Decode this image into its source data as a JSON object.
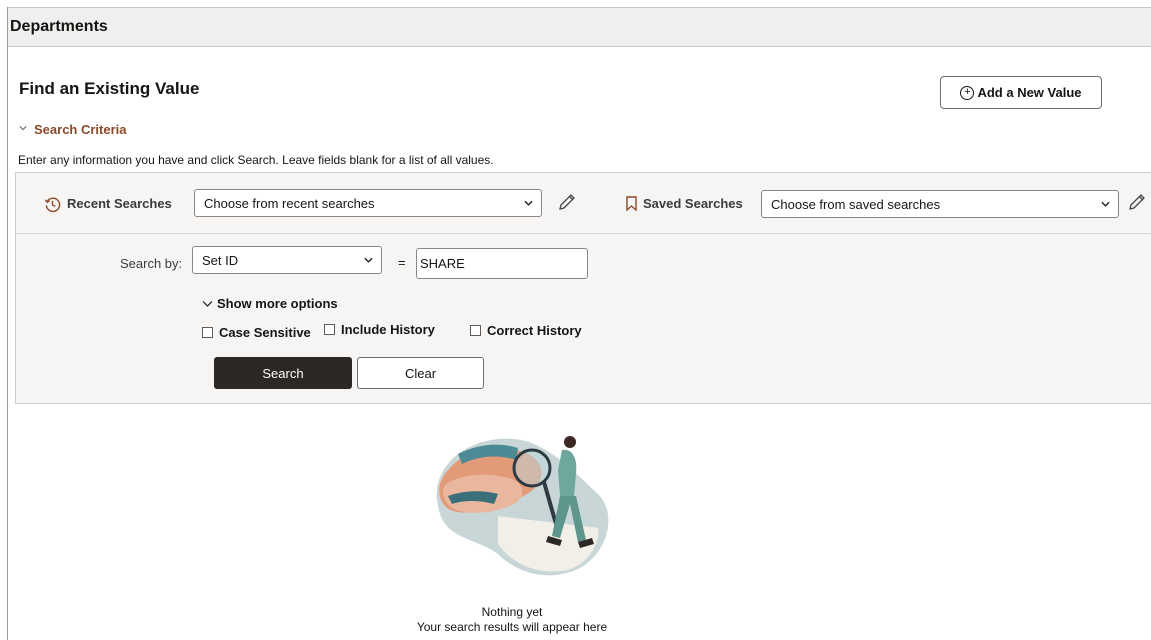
{
  "header": {
    "title": "Departments"
  },
  "page": {
    "heading": "Find an Existing Value",
    "add_button_label": "Add a New Value"
  },
  "criteria": {
    "toggle_label": "Search Criteria",
    "instructions": "Enter any information you have and click Search. Leave fields blank for a list of all values."
  },
  "recent": {
    "label": "Recent Searches",
    "select_value": "Choose from recent searches"
  },
  "saved": {
    "label": "Saved Searches",
    "select_value": "Choose from saved searches"
  },
  "search_by": {
    "label": "Search by:",
    "field_value": "Set ID",
    "operator": "=",
    "input_value": "SHARE"
  },
  "options": {
    "toggle_label": "Show more options",
    "case_sensitive": "Case Sensitive",
    "include_history": "Include History",
    "correct_history": "Correct History"
  },
  "buttons": {
    "search": "Search",
    "clear": "Clear"
  },
  "empty_state": {
    "title": "Nothing yet",
    "subtitle": "Your search results will appear here"
  },
  "colors": {
    "link_accent": "#8b4a2b",
    "header_bg": "#f1efed",
    "primary_button": "#2b2826"
  },
  "icons": {
    "recent": "history-icon",
    "saved": "bookmark-icon",
    "edit": "pencil-icon",
    "add": "plus-circle-icon",
    "expand": "chevron-down-icon"
  }
}
